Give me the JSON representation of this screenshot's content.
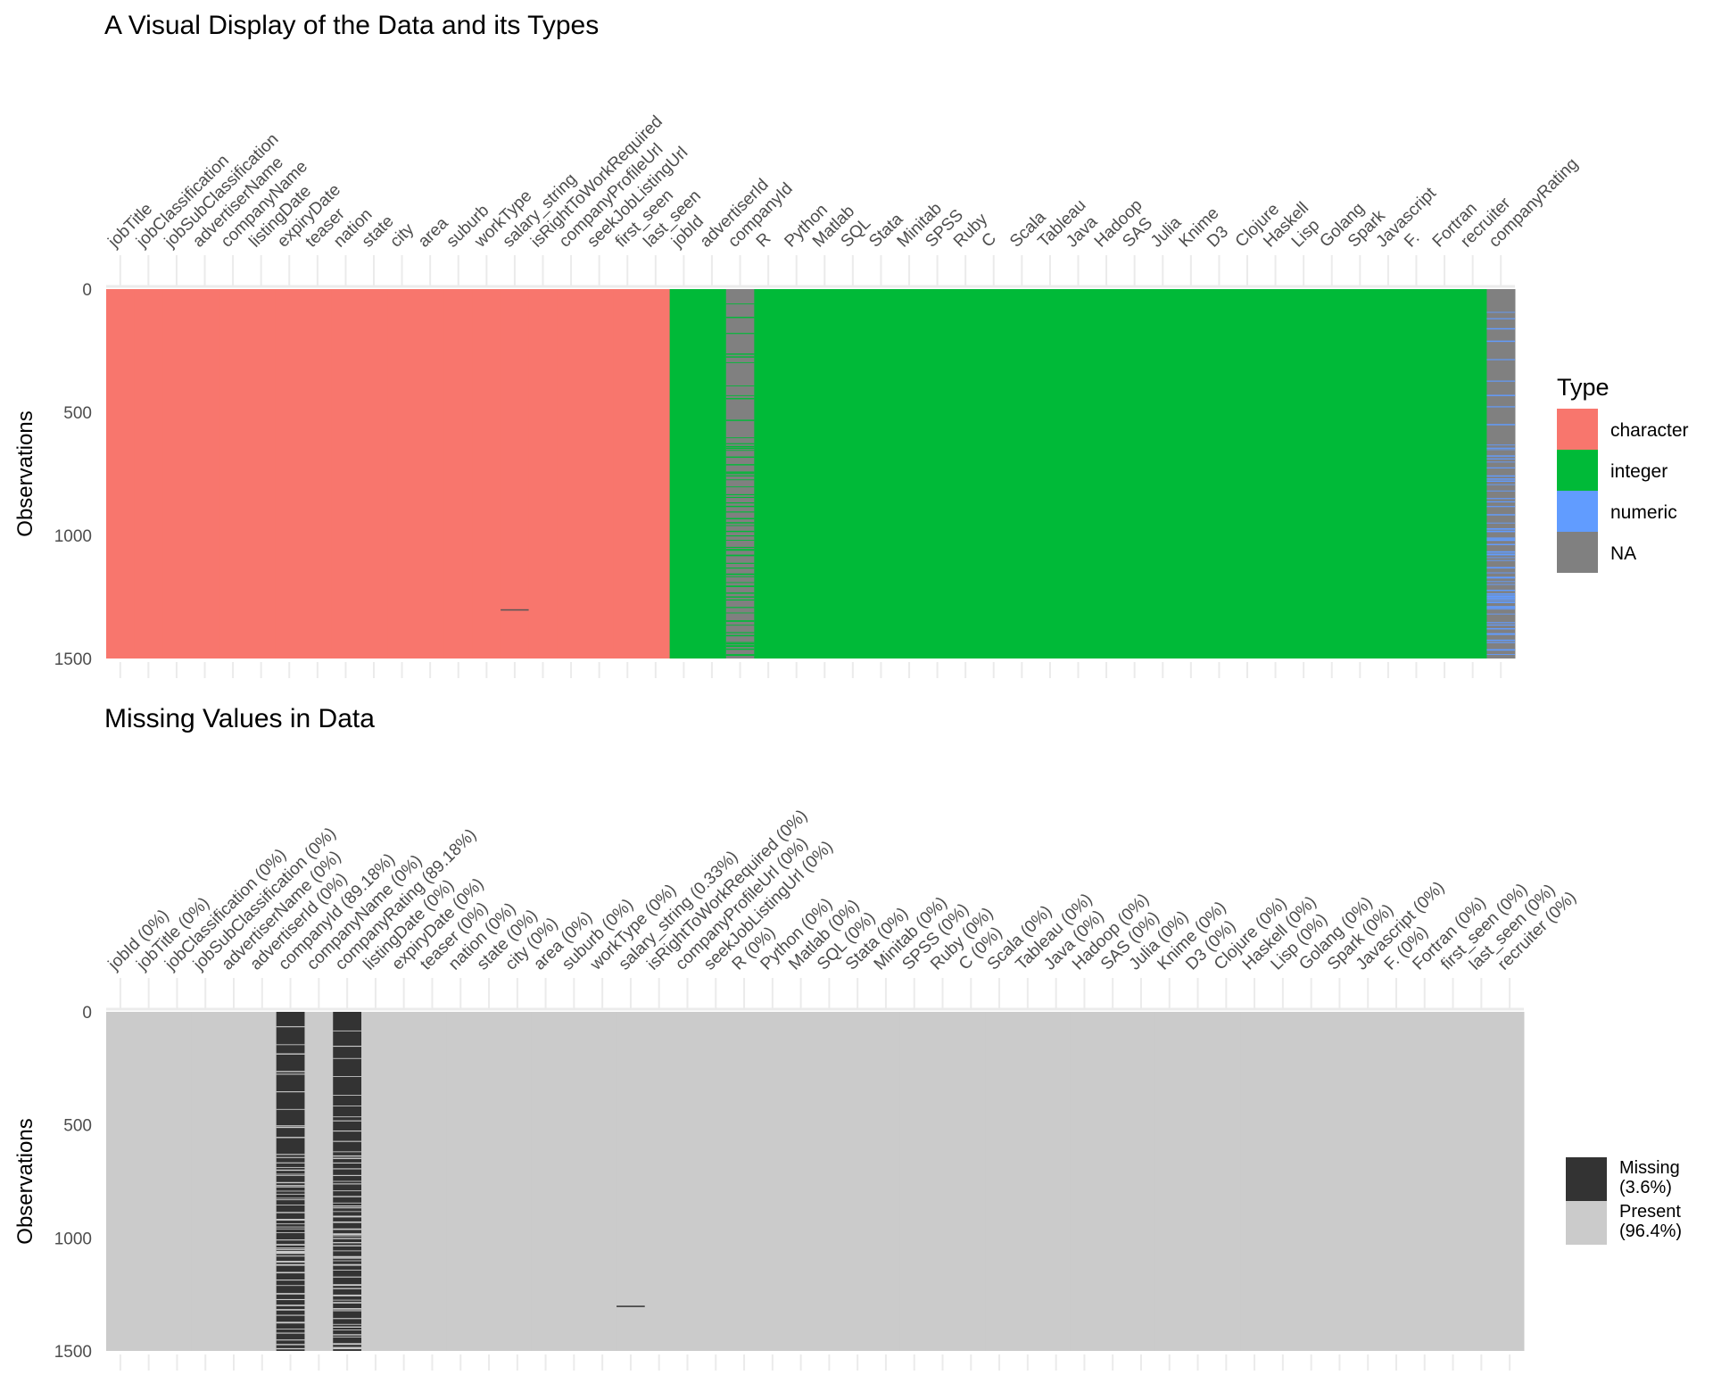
{
  "chart_data": [
    {
      "type": "heatmap",
      "title": "A Visual Display of the Data and its Types",
      "xlabel": "",
      "ylabel": "Observations",
      "y_ticks": [
        0,
        500,
        1000,
        1500
      ],
      "ylim": [
        0,
        1500
      ],
      "grid": true,
      "legend": {
        "title": "Type",
        "placement": "right",
        "entries": [
          {
            "label": "character",
            "color": "#F8766D"
          },
          {
            "label": "integer",
            "color": "#00BA38"
          },
          {
            "label": "numeric",
            "color": "#619CFF"
          },
          {
            "label": "NA",
            "color": "#808080"
          }
        ]
      },
      "columns": [
        {
          "name": "jobTitle",
          "type": "character"
        },
        {
          "name": "jobClassification",
          "type": "character"
        },
        {
          "name": "jobSubClassification",
          "type": "character"
        },
        {
          "name": "advertiserName",
          "type": "character"
        },
        {
          "name": "companyName",
          "type": "character"
        },
        {
          "name": "listingDate",
          "type": "character"
        },
        {
          "name": "expiryDate",
          "type": "character"
        },
        {
          "name": "teaser",
          "type": "character"
        },
        {
          "name": "nation",
          "type": "character"
        },
        {
          "name": "state",
          "type": "character"
        },
        {
          "name": "city",
          "type": "character"
        },
        {
          "name": "area",
          "type": "character"
        },
        {
          "name": "suburb",
          "type": "character"
        },
        {
          "name": "workType",
          "type": "character"
        },
        {
          "name": "salary_string",
          "type": "character",
          "missing_pct": 0.33
        },
        {
          "name": "isRightToWorkRequired",
          "type": "character"
        },
        {
          "name": "companyProfileUrl",
          "type": "character"
        },
        {
          "name": "seekJobListingUrl",
          "type": "character"
        },
        {
          "name": "first_seen",
          "type": "character"
        },
        {
          "name": "last_seen",
          "type": "character"
        },
        {
          "name": "jobId",
          "type": "integer"
        },
        {
          "name": "advertiserId",
          "type": "integer"
        },
        {
          "name": "companyId",
          "type": "integer",
          "missing_pct": 89.18
        },
        {
          "name": "R",
          "type": "integer"
        },
        {
          "name": "Python",
          "type": "integer"
        },
        {
          "name": "Matlab",
          "type": "integer"
        },
        {
          "name": "SQL",
          "type": "integer"
        },
        {
          "name": "Stata",
          "type": "integer"
        },
        {
          "name": "Minitab",
          "type": "integer"
        },
        {
          "name": "SPSS",
          "type": "integer"
        },
        {
          "name": "Ruby",
          "type": "integer"
        },
        {
          "name": "C",
          "type": "integer"
        },
        {
          "name": "Scala",
          "type": "integer"
        },
        {
          "name": "Tableau",
          "type": "integer"
        },
        {
          "name": "Java",
          "type": "integer"
        },
        {
          "name": "Hadoop",
          "type": "integer"
        },
        {
          "name": "SAS",
          "type": "integer"
        },
        {
          "name": "Julia",
          "type": "integer"
        },
        {
          "name": "Knime",
          "type": "integer"
        },
        {
          "name": "D3",
          "type": "integer"
        },
        {
          "name": "Clojure",
          "type": "integer"
        },
        {
          "name": "Haskell",
          "type": "integer"
        },
        {
          "name": "Lisp",
          "type": "integer"
        },
        {
          "name": "Golang",
          "type": "integer"
        },
        {
          "name": "Spark",
          "type": "integer"
        },
        {
          "name": "Javascript",
          "type": "integer"
        },
        {
          "name": "F.",
          "type": "integer"
        },
        {
          "name": "Fortran",
          "type": "integer"
        },
        {
          "name": "recruiter",
          "type": "integer"
        },
        {
          "name": "companyRating",
          "type": "numeric",
          "missing_pct": 89.18
        }
      ]
    },
    {
      "type": "heatmap",
      "title": "Missing Values in Data",
      "xlabel": "",
      "ylabel": "Observations",
      "y_ticks": [
        0,
        500,
        1000,
        1500
      ],
      "ylim": [
        0,
        1500
      ],
      "grid": true,
      "legend": {
        "placement": "right",
        "entries": [
          {
            "label": "Missing",
            "pct": "(3.6%)",
            "color": "#333333"
          },
          {
            "label": "Present",
            "pct": "(96.4%)",
            "color": "#CBCBCB"
          }
        ]
      },
      "columns": [
        {
          "label": "jobId (0%)",
          "pct": 0
        },
        {
          "label": "jobTitle (0%)",
          "pct": 0
        },
        {
          "label": "jobClassification (0%)",
          "pct": 0
        },
        {
          "label": "jobSubClassification (0%)",
          "pct": 0
        },
        {
          "label": "advertiserName (0%)",
          "pct": 0
        },
        {
          "label": "advertiserId (0%)",
          "pct": 0
        },
        {
          "label": "companyId (89.18%)",
          "pct": 89.18
        },
        {
          "label": "companyName (0%)",
          "pct": 0
        },
        {
          "label": "companyRating (89.18%)",
          "pct": 89.18
        },
        {
          "label": "listingDate (0%)",
          "pct": 0
        },
        {
          "label": "expiryDate (0%)",
          "pct": 0
        },
        {
          "label": "teaser (0%)",
          "pct": 0
        },
        {
          "label": "nation (0%)",
          "pct": 0
        },
        {
          "label": "state (0%)",
          "pct": 0
        },
        {
          "label": "city (0%)",
          "pct": 0
        },
        {
          "label": "area (0%)",
          "pct": 0
        },
        {
          "label": "suburb (0%)",
          "pct": 0
        },
        {
          "label": "workType (0%)",
          "pct": 0
        },
        {
          "label": "salary_string (0.33%)",
          "pct": 0.33
        },
        {
          "label": "isRightToWorkRequired (0%)",
          "pct": 0
        },
        {
          "label": "companyProfileUrl (0%)",
          "pct": 0
        },
        {
          "label": "seekJobListingUrl (0%)",
          "pct": 0
        },
        {
          "label": "R (0%)",
          "pct": 0
        },
        {
          "label": "Python (0%)",
          "pct": 0
        },
        {
          "label": "Matlab (0%)",
          "pct": 0
        },
        {
          "label": "SQL (0%)",
          "pct": 0
        },
        {
          "label": "Stata (0%)",
          "pct": 0
        },
        {
          "label": "Minitab (0%)",
          "pct": 0
        },
        {
          "label": "SPSS (0%)",
          "pct": 0
        },
        {
          "label": "Ruby (0%)",
          "pct": 0
        },
        {
          "label": "C (0%)",
          "pct": 0
        },
        {
          "label": "Scala (0%)",
          "pct": 0
        },
        {
          "label": "Tableau (0%)",
          "pct": 0
        },
        {
          "label": "Java (0%)",
          "pct": 0
        },
        {
          "label": "Hadoop (0%)",
          "pct": 0
        },
        {
          "label": "SAS (0%)",
          "pct": 0
        },
        {
          "label": "Julia (0%)",
          "pct": 0
        },
        {
          "label": "Knime (0%)",
          "pct": 0
        },
        {
          "label": "D3 (0%)",
          "pct": 0
        },
        {
          "label": "Clojure (0%)",
          "pct": 0
        },
        {
          "label": "Haskell (0%)",
          "pct": 0
        },
        {
          "label": "Lisp (0%)",
          "pct": 0
        },
        {
          "label": "Golang (0%)",
          "pct": 0
        },
        {
          "label": "Spark (0%)",
          "pct": 0
        },
        {
          "label": "Javascript (0%)",
          "pct": 0
        },
        {
          "label": "F. (0%)",
          "pct": 0
        },
        {
          "label": "Fortran (0%)",
          "pct": 0
        },
        {
          "label": "first_seen (0%)",
          "pct": 0
        },
        {
          "label": "last_seen (0%)",
          "pct": 0
        },
        {
          "label": "recruiter (0%)",
          "pct": 0
        }
      ]
    }
  ]
}
